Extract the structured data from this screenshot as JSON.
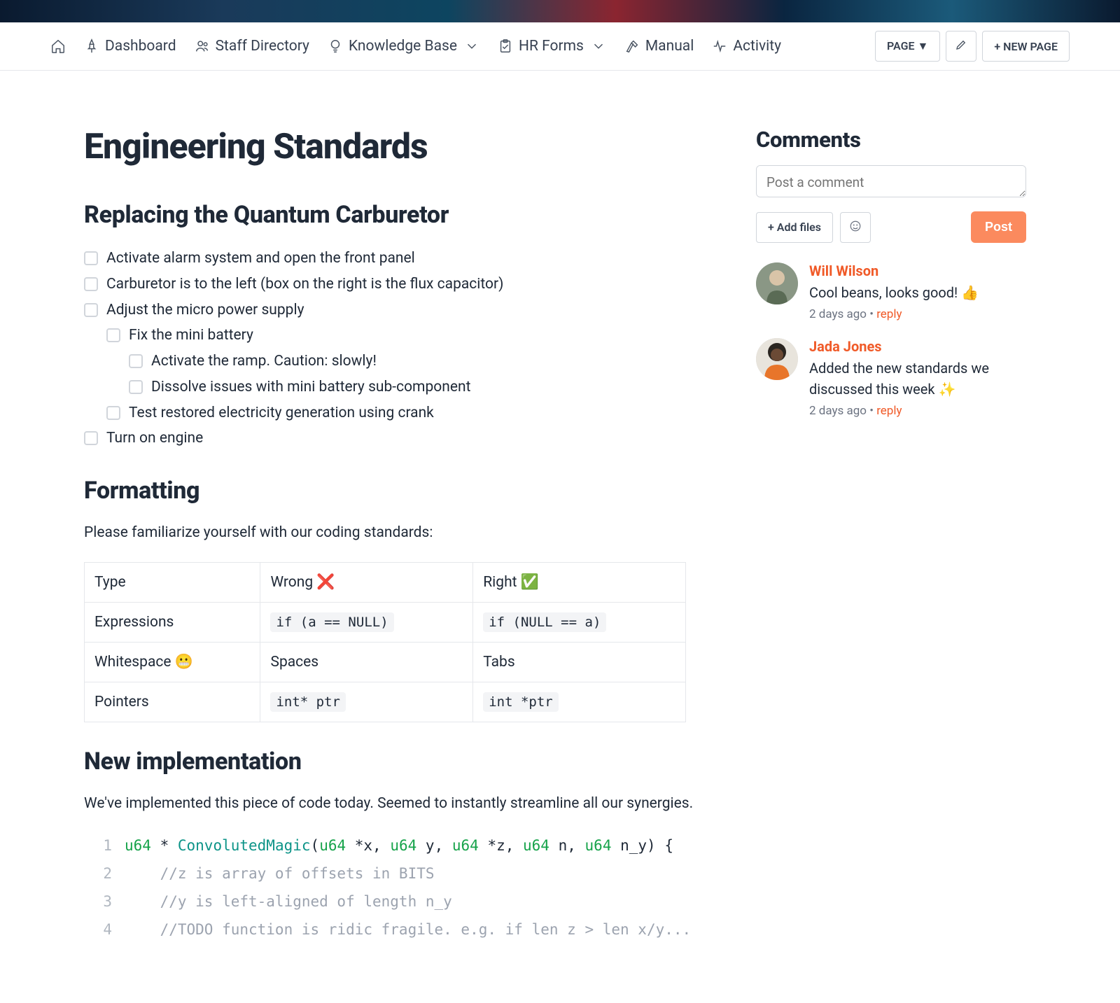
{
  "nav": {
    "items": [
      {
        "label": "Dashboard"
      },
      {
        "label": "Staff Directory"
      },
      {
        "label": "Knowledge Base"
      },
      {
        "label": "HR Forms"
      },
      {
        "label": "Manual"
      },
      {
        "label": "Activity"
      }
    ],
    "page_btn": "PAGE ▼",
    "new_page_btn": "+ NEW PAGE"
  },
  "page": {
    "title": "Engineering Standards",
    "section_replace": "Replacing the Quantum Carburetor",
    "checklist": {
      "i0": "Activate alarm system and open the front panel",
      "i1": "Carburetor is to the left (box on the right is the flux capacitor)",
      "i2": "Adjust the micro power supply",
      "i2a": "Fix the mini battery",
      "i2a1": "Activate the ramp. Caution: slowly!",
      "i2a2": "Dissolve issues with mini battery sub-component",
      "i2b": "Test restored electricity generation using crank",
      "i3": "Turn on engine"
    },
    "section_formatting": "Formatting",
    "formatting_intro": "Please familiarize yourself with our coding standards:",
    "table": {
      "h_type": "Type",
      "h_wrong": "Wrong ",
      "h_right": "Right ",
      "r1_type": "Expressions",
      "r1_wrong": "if (a == NULL)",
      "r1_right": "if (NULL == a)",
      "r2_type": "Whitespace ",
      "r2_wrong": "Spaces",
      "r2_right": "Tabs",
      "r3_type": "Pointers",
      "r3_wrong": "int* ptr",
      "r3_right": "int *ptr"
    },
    "section_newimpl": "New implementation",
    "newimpl_intro": "We've implemented this piece of code today. Seemed to instantly streamline all our synergies.",
    "code": {
      "l1_type1": "u64",
      "l1_mid1": " * ",
      "l1_func": "ConvolutedMagic",
      "l1_mid2": "(",
      "l1_type2": "u64",
      "l1_p1": " *x, ",
      "l1_type3": "u64",
      "l1_p2": " y, ",
      "l1_type4": "u64",
      "l1_p3": " *z, ",
      "l1_type5": "u64",
      "l1_p4": " n, ",
      "l1_type6": "u64",
      "l1_p5": " n_y) {",
      "l2": "    //z is array of offsets in BITS",
      "l3": "    //y is left-aligned of length n_y",
      "l4": "    //TODO function is ridic fragile. e.g. if len z > len x/y..."
    }
  },
  "comments": {
    "heading": "Comments",
    "placeholder": "Post a comment",
    "add_files": "+ Add files",
    "post": "Post",
    "list": [
      {
        "author": "Will Wilson",
        "text": "Cool beans, looks good! 👍",
        "time": "2 days ago",
        "reply": "reply"
      },
      {
        "author": "Jada Jones",
        "text": "Added the new standards we discussed this week ✨",
        "time": "2 days ago",
        "reply": "reply"
      }
    ]
  }
}
